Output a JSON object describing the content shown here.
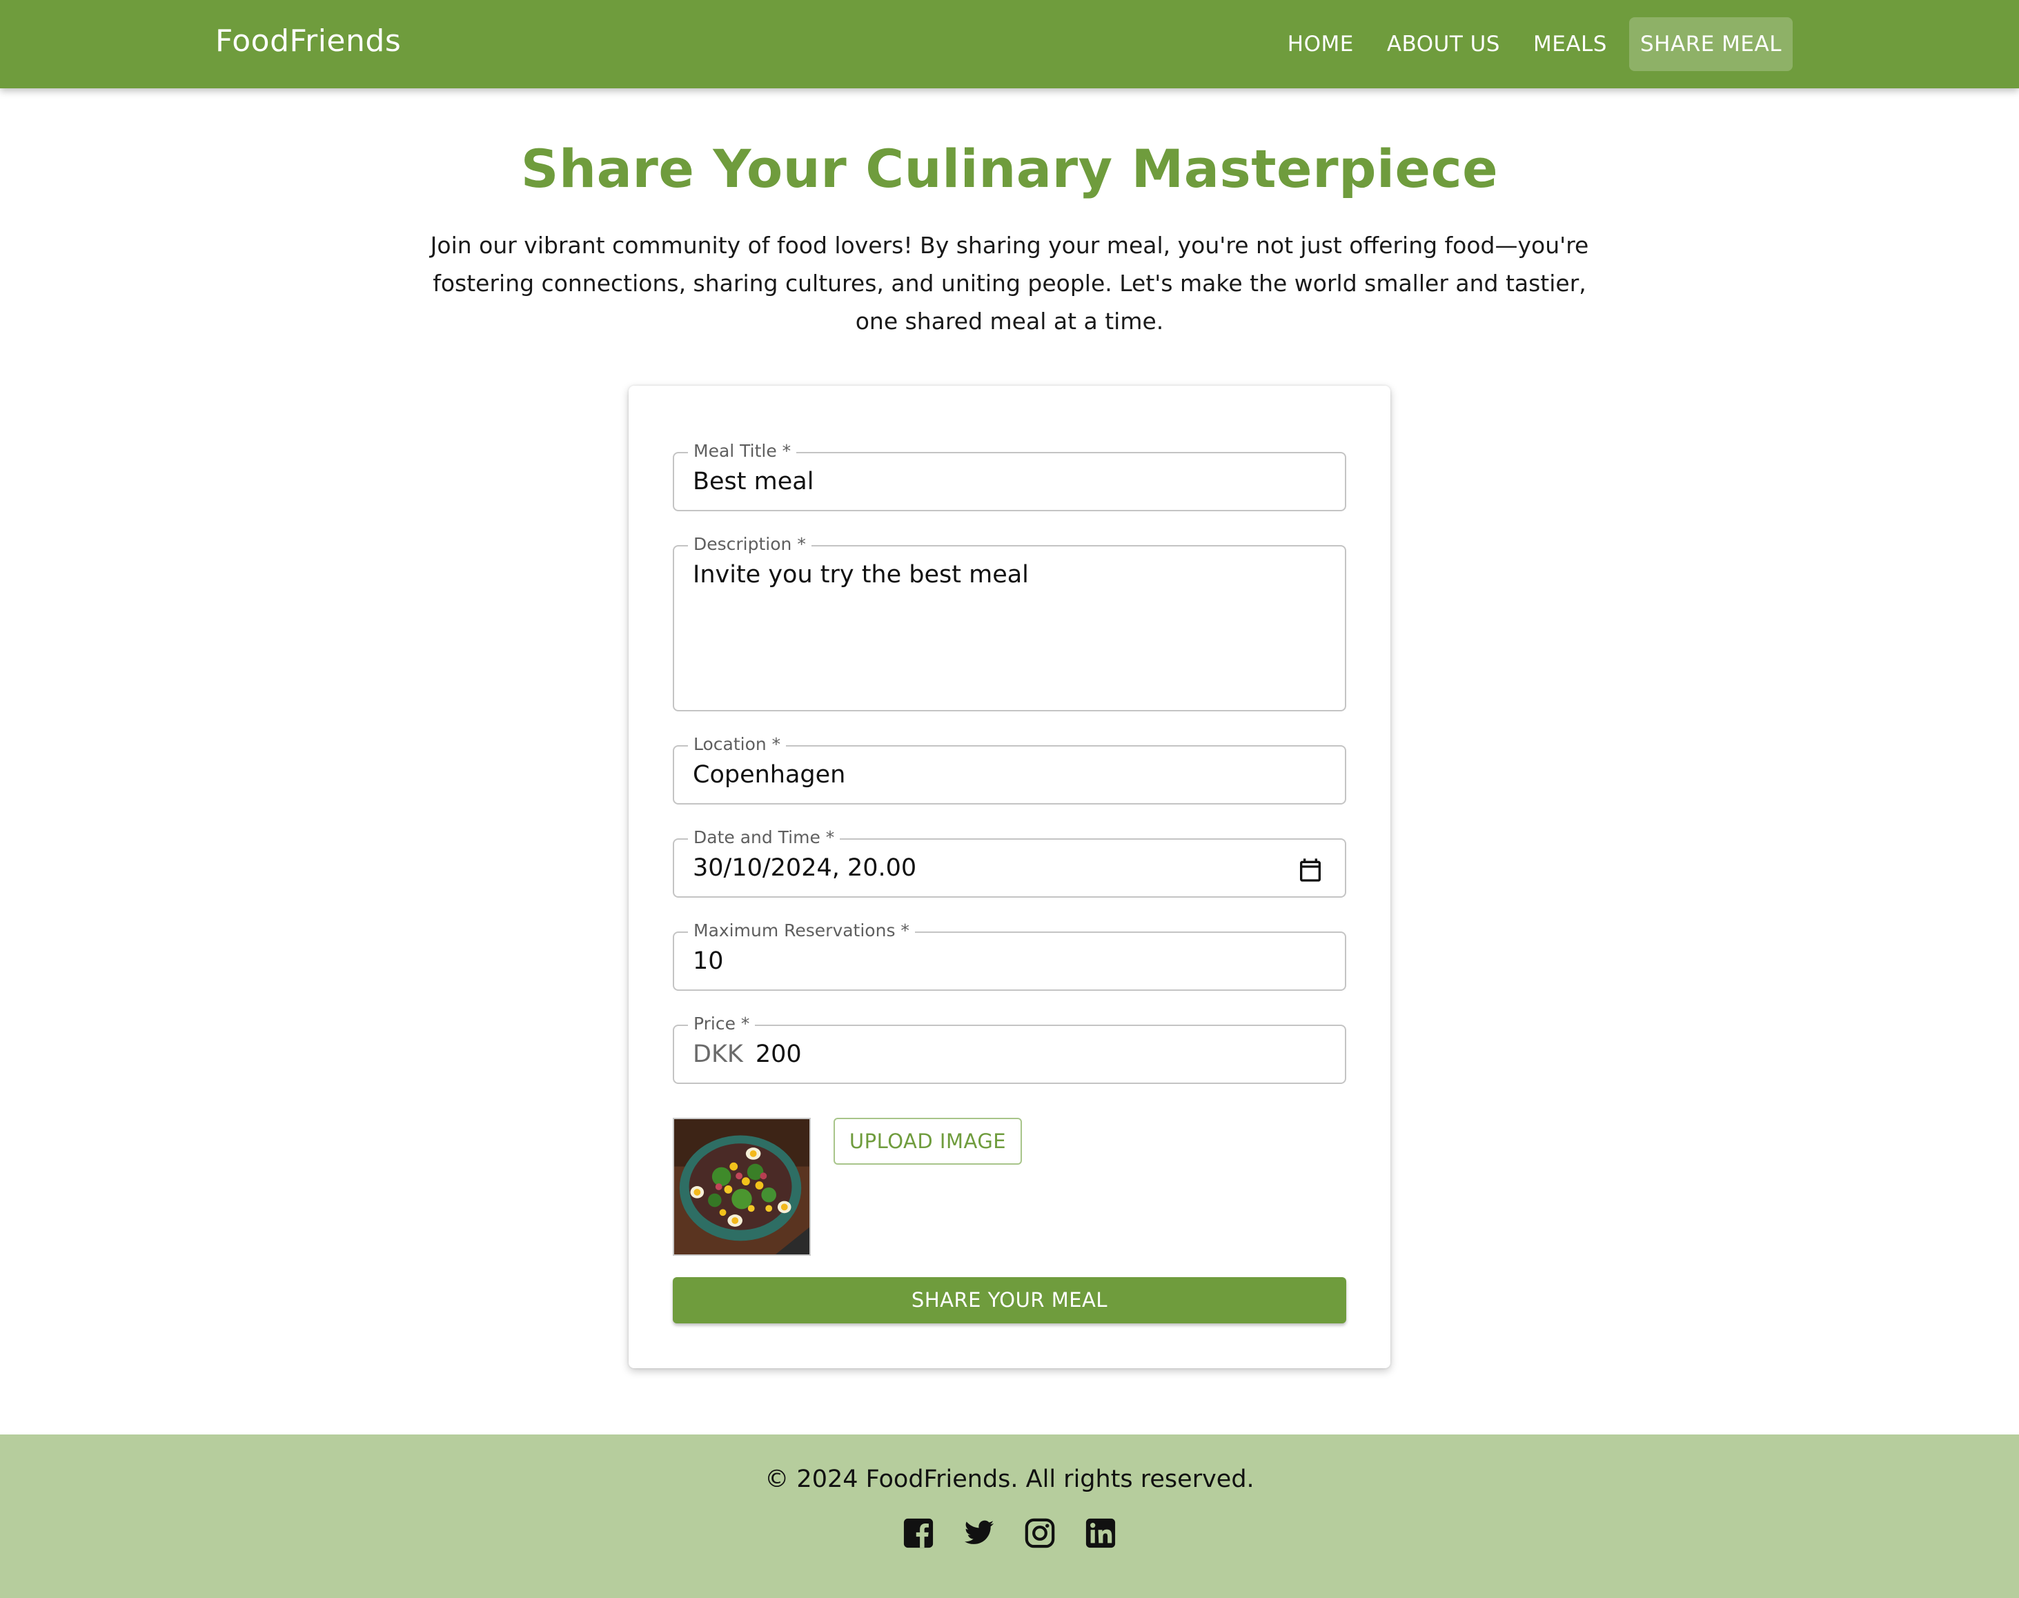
{
  "header": {
    "brand": "FoodFriends",
    "nav": [
      {
        "label": "HOME",
        "active": false
      },
      {
        "label": "ABOUT US",
        "active": false
      },
      {
        "label": "MEALS",
        "active": false
      },
      {
        "label": "SHARE MEAL",
        "active": true
      }
    ]
  },
  "hero": {
    "title": "Share Your Culinary Masterpiece",
    "text": "Join our vibrant community of food lovers! By sharing your meal, you're not just offering food—you're fostering connections, sharing cultures, and uniting people. Let's make the world smaller and tastier, one shared meal at a time."
  },
  "form": {
    "title": {
      "label": "Meal Title *",
      "value": "Best meal"
    },
    "description": {
      "label": "Description *",
      "value": "Invite you try the best meal"
    },
    "location": {
      "label": "Location *",
      "value": "Copenhagen"
    },
    "datetime": {
      "label": "Date and Time *",
      "value": "30/10/2024, 20.00",
      "icon": "calendar-icon"
    },
    "max_reservations": {
      "label": "Maximum Reservations *",
      "value": "10"
    },
    "price": {
      "label": "Price *",
      "prefix": "DKK",
      "value": "200"
    },
    "upload_label": "UPLOAD IMAGE",
    "submit_label": "SHARE YOUR MEAL"
  },
  "footer": {
    "copyright": "© 2024 FoodFriends. All rights reserved.",
    "socials": [
      "facebook-icon",
      "twitter-icon",
      "instagram-icon",
      "linkedin-icon"
    ]
  },
  "colors": {
    "primary": "#6f9c3d",
    "footer_bg": "#b6cd9d"
  }
}
